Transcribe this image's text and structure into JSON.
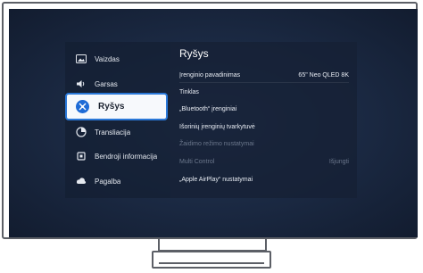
{
  "menu": {
    "items": [
      {
        "icon": "picture-icon",
        "label": "Vaizdas"
      },
      {
        "icon": "sound-icon",
        "label": "Garsas"
      },
      {
        "icon": "broadcast-icon",
        "label": "Transliacija"
      },
      {
        "icon": "general-icon",
        "label": "Bendroji informacija"
      },
      {
        "icon": "support-icon",
        "label": "Pagalba"
      }
    ],
    "selected": {
      "icon": "connection-icon",
      "label": "Ryšys"
    }
  },
  "content": {
    "title": "Ryšys",
    "rows": [
      {
        "label": "Įrenginio pavadinimas",
        "value": "65\" Neo QLED 8K",
        "disabled": false
      },
      {
        "label": "Tinklas",
        "value": "",
        "disabled": false
      },
      {
        "label": "„Bluetooth“ įrenginiai",
        "value": "",
        "disabled": false
      },
      {
        "label": "Išorinių įrenginių tvarkytuvė",
        "value": "",
        "disabled": false
      },
      {
        "label": "Žaidimo režimo nustatymai",
        "value": "",
        "disabled": true
      },
      {
        "label": "Multi Control",
        "value": "Išjungti",
        "disabled": true
      },
      {
        "label": "„Apple AirPlay“ nustatymai",
        "value": "",
        "disabled": false
      }
    ]
  },
  "colors": {
    "selected_border": "#2a78d8",
    "selected_icon": "#1e6bd6",
    "screen_bg": "#1a2841"
  }
}
